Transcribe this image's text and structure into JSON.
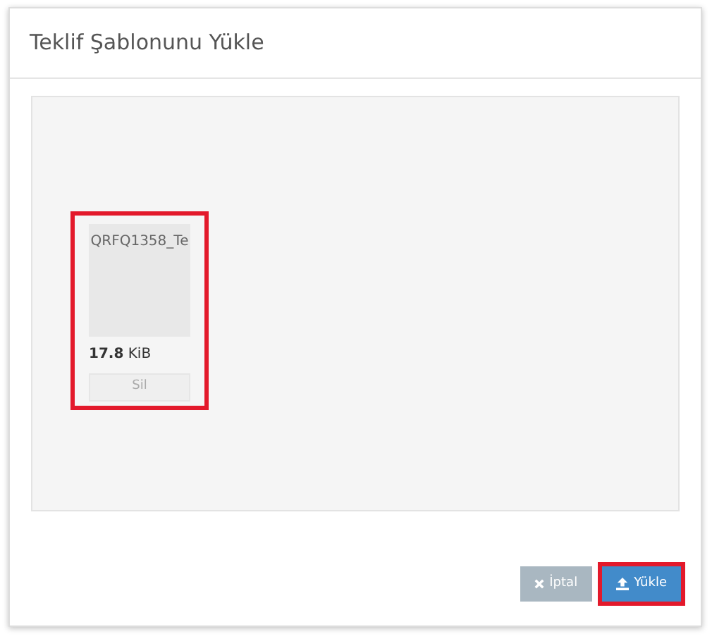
{
  "dialog": {
    "title": "Teklif Şablonunu Yükle"
  },
  "files": [
    {
      "name": "QRFQ1358_Te",
      "size": "**17.8** KiB",
      "remove_label": "Sil",
      "highlighted": true
    }
  ],
  "buttons": [
    {
      "kind": "cancel",
      "label": "İptal",
      "highlighted": false
    },
    {
      "kind": "upload",
      "label": "Yükle",
      "highlighted": true
    }
  ]
}
